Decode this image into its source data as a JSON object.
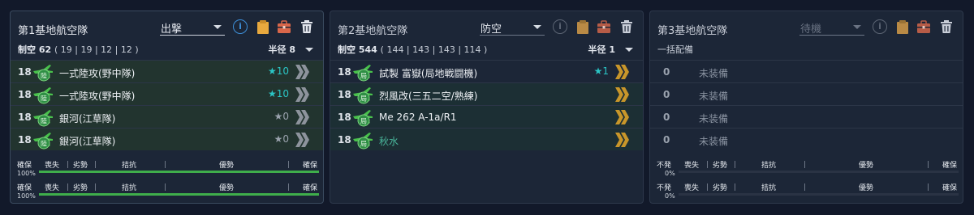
{
  "panels": [
    {
      "title": "第1基地航空隊",
      "mode": "出撃",
      "air_label": "制空",
      "air_value": "62",
      "air_detail": "( 19 | 19 | 12 | 12 )",
      "radius_label": "半径",
      "radius_value": "8",
      "rows": [
        {
          "count": "18",
          "name": "一式陸攻(野中隊)",
          "stars": "★10",
          "star_color": "cyan",
          "chevron": "gray"
        },
        {
          "count": "18",
          "name": "一式陸攻(野中隊)",
          "stars": "★10",
          "star_color": "cyan",
          "chevron": "gray"
        },
        {
          "count": "18",
          "name": "銀河(江草隊)",
          "stars": "★0",
          "star_color": "gray",
          "chevron": "gray"
        },
        {
          "count": "18",
          "name": "銀河(江草隊)",
          "stars": "★0",
          "star_color": "gray",
          "chevron": "gray"
        }
      ],
      "bars": [
        {
          "left": "確保",
          "pct": "100%",
          "segs": [
            "喪失",
            "劣勢",
            "拮抗",
            "優勢",
            "確保"
          ],
          "progress": 1.0
        },
        {
          "left": "確保",
          "pct": "100%",
          "segs": [
            "喪失",
            "劣勢",
            "拮抗",
            "優勢",
            "確保"
          ],
          "progress": 1.0
        }
      ]
    },
    {
      "title": "第2基地航空隊",
      "mode": "防空",
      "air_label": "制空",
      "air_value": "544",
      "air_detail": "( 144 | 143 | 143 | 114 )",
      "radius_label": "半径",
      "radius_value": "1",
      "rows": [
        {
          "count": "18",
          "name": "試製 富嶽(局地戦闘機)",
          "stars": "★1",
          "star_color": "cyan",
          "chevron": "gold"
        },
        {
          "count": "18",
          "name": "烈風改(三五二空/熟練)",
          "stars": "",
          "star_color": "",
          "chevron": "gold"
        },
        {
          "count": "18",
          "name": "Me 262 A-1a/R1",
          "stars": "",
          "star_color": "",
          "chevron": "gold"
        },
        {
          "count": "18",
          "name": "秋水",
          "stars": "",
          "star_color": "",
          "chevron": "gold",
          "teal": true
        }
      ]
    },
    {
      "title": "第3基地航空隊",
      "mode": "待機",
      "batch_label": "一括配備",
      "rows": [
        {
          "count": "0",
          "name": "未装備"
        },
        {
          "count": "0",
          "name": "未装備"
        },
        {
          "count": "0",
          "name": "未装備"
        },
        {
          "count": "0",
          "name": "未装備"
        }
      ],
      "bars": [
        {
          "left": "不発",
          "pct": "0%",
          "segs": [
            "喪失",
            "劣勢",
            "拮抗",
            "優勢",
            "確保"
          ],
          "progress": 0
        },
        {
          "left": "不発",
          "pct": "0%",
          "segs": [
            "喪失",
            "劣勢",
            "拮抗",
            "優勢",
            "確保"
          ],
          "progress": 0
        }
      ]
    }
  ],
  "colors": {
    "plane_green": "#49c14c",
    "badge_green": "#2f8f45",
    "chevron_gray": "#8d939c",
    "chevron_gold": "#c8962a",
    "info_blue": "#3d8fd9",
    "clip_orange": "#e8a93e",
    "box_red": "#d9674a",
    "progress_green": "#3fae4b"
  },
  "icons": {
    "info": "info-icon",
    "clipboard": "clipboard-icon",
    "toolbox": "toolbox-icon",
    "trash": "trash-icon",
    "plane": "plane-icon",
    "chevron": "double-chevron-icon"
  }
}
